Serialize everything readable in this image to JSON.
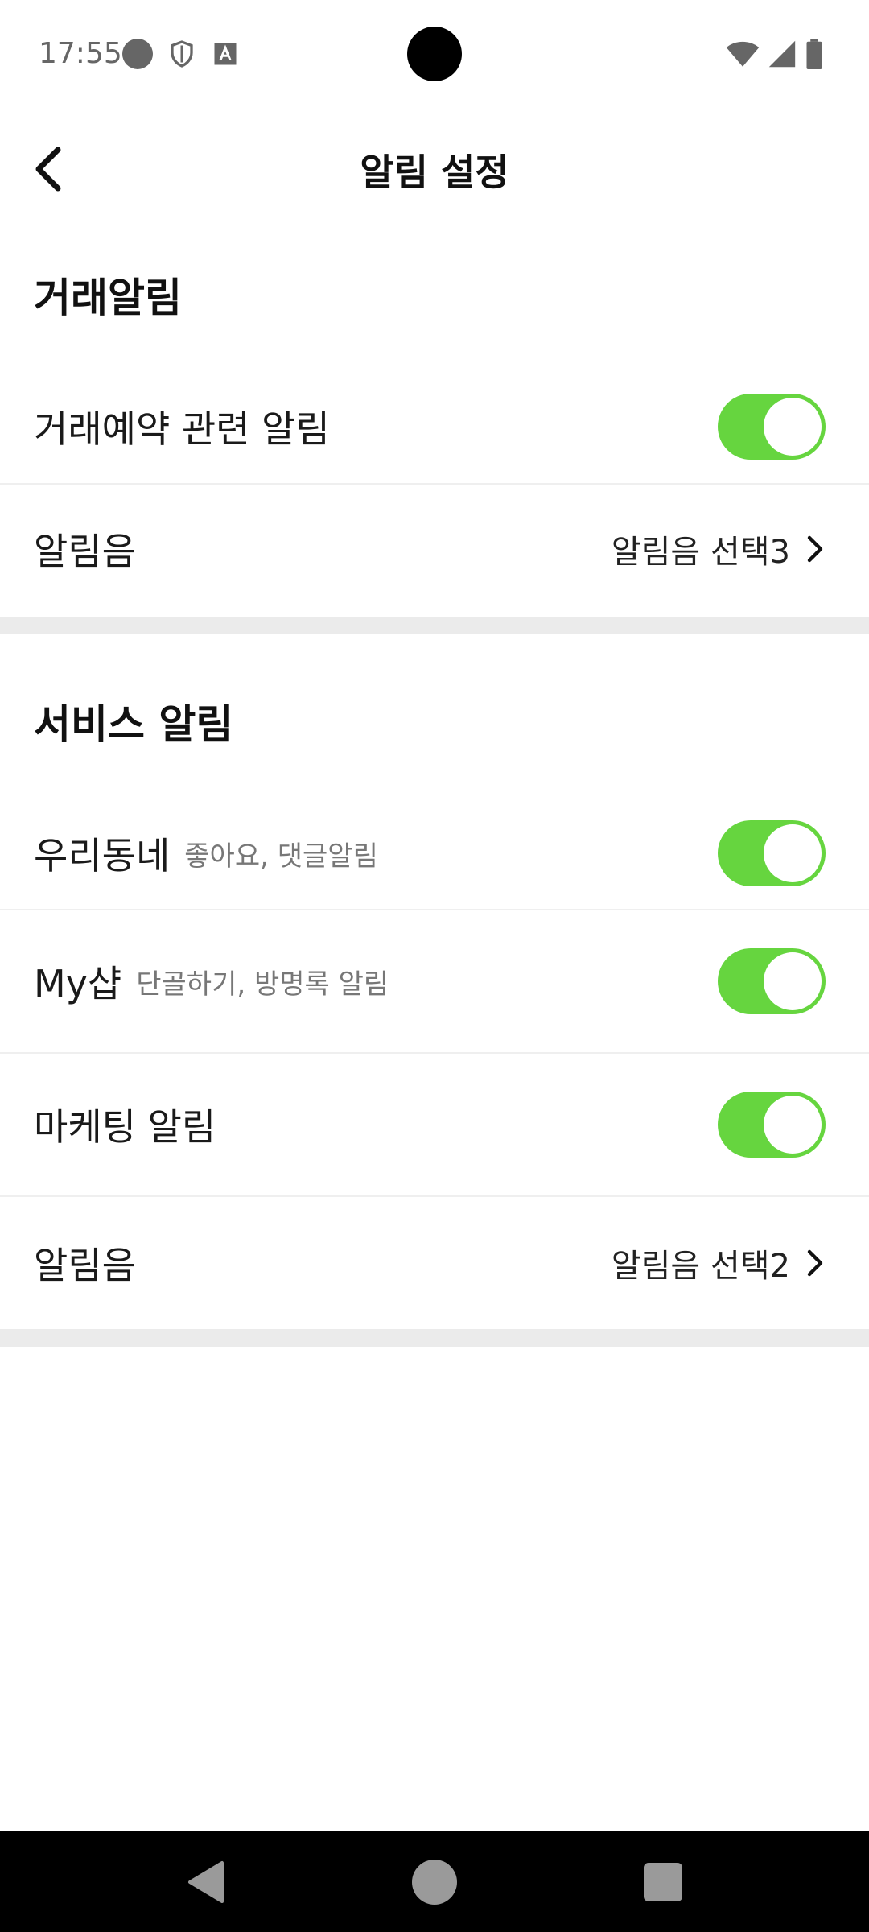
{
  "status_bar": {
    "time": "17:55",
    "icons_left": [
      "circle-notification-icon",
      "shield-icon",
      "a-text-icon"
    ],
    "icons_right": [
      "wifi-icon",
      "signal-icon",
      "battery-icon"
    ]
  },
  "header": {
    "title": "알림 설정",
    "back_icon": "chevron-left-icon"
  },
  "trade_section": {
    "title": "거래알림",
    "rows": [
      {
        "label": "거래예약 관련 알림",
        "toggle_on": true
      },
      {
        "label": "알림음",
        "value": "알림음 선택3"
      }
    ]
  },
  "service_section": {
    "title": "서비스 알림",
    "rows": [
      {
        "label": "우리동네",
        "sub": "좋아요, 댓글알림",
        "toggle_on": true
      },
      {
        "label": "My샵",
        "sub": "단골하기, 방명록 알림",
        "toggle_on": true
      },
      {
        "label": "마케팅 알림",
        "toggle_on": true
      },
      {
        "label": "알림음",
        "value": "알림음 선택2"
      }
    ]
  },
  "colors": {
    "toggle_on": "#66d53f",
    "section_gap": "#ebebeb",
    "divider": "#efefef"
  },
  "nav_bar": {
    "icons": [
      "back-triangle-icon",
      "home-circle-icon",
      "recents-square-icon"
    ]
  }
}
